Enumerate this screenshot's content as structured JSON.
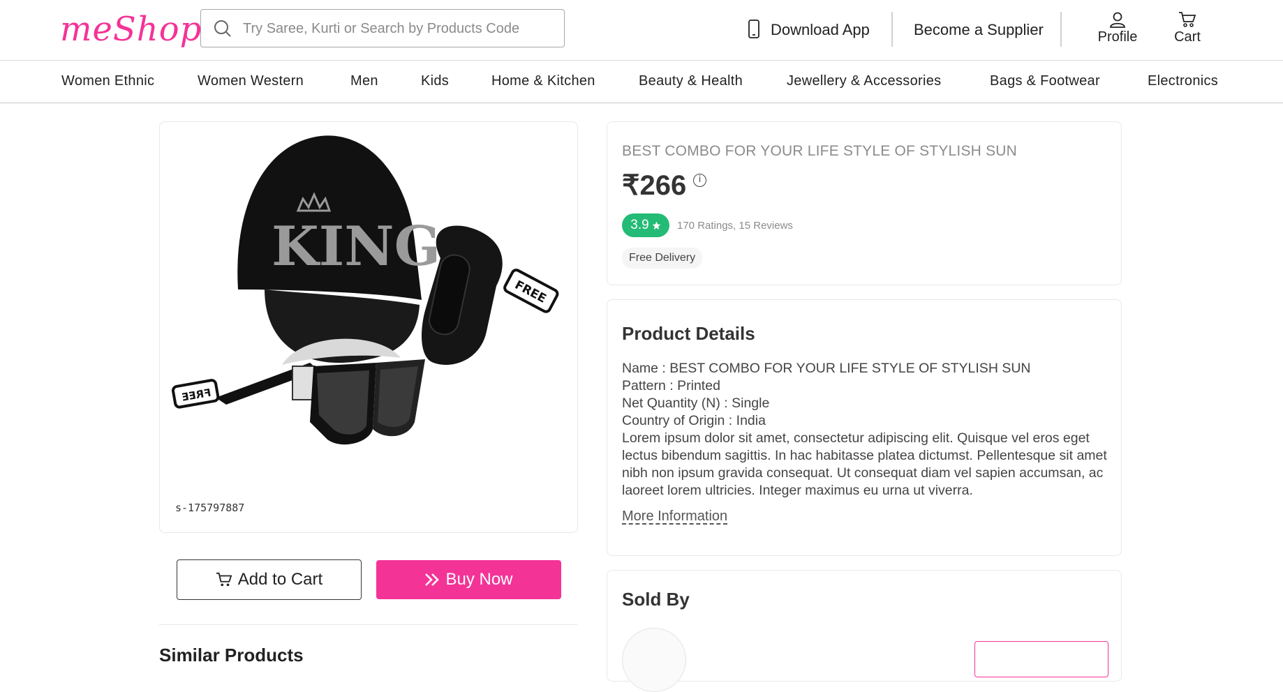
{
  "brand": {
    "logo": "meShop",
    "accent": "#f43397"
  },
  "search": {
    "placeholder": "Try Saree, Kurti or Search by Products Code"
  },
  "header": {
    "download_app": "Download App",
    "become_supplier": "Become a Supplier",
    "profile": "Profile",
    "cart": "Cart"
  },
  "categories": [
    "Women Ethnic",
    "Women Western",
    "Men",
    "Kids",
    "Home & Kitchen",
    "Beauty & Health",
    "Jewellery & Accessories",
    "Bags & Footwear",
    "Electronics"
  ],
  "product": {
    "title": "BEST COMBO FOR YOUR LIFE STYLE OF STYLISH SUN",
    "price": "₹266",
    "rating": "3.9",
    "rating_summary": "170 Ratings, 15 Reviews",
    "rating_color": "#23bb75",
    "delivery": "Free Delivery",
    "image_code": "s-175797887",
    "image_cap_text": "KING",
    "image_tag_text": "FREE"
  },
  "actions": {
    "add_to_cart": "Add to Cart",
    "buy_now": "Buy Now"
  },
  "details": {
    "heading": "Product Details",
    "lines": [
      "Name : BEST COMBO FOR YOUR LIFE STYLE OF STYLISH SUN",
      "Pattern : Printed",
      "Net Quantity (N) : Single",
      "Country of Origin : India"
    ],
    "description": "Lorem ipsum dolor sit amet, consectetur adipiscing elit. Quisque vel eros eget lectus bibendum sagittis. In hac habitasse platea dictumst. Pellentesque sit amet nibh non ipsum gravida consequat. Ut consequat diam vel sapien accumsan, ac laoreet lorem ultricies. Integer maximus eu urna ut viverra.",
    "more": "More Information"
  },
  "sold_by": {
    "heading": "Sold By"
  },
  "similar": {
    "heading": "Similar Products"
  }
}
